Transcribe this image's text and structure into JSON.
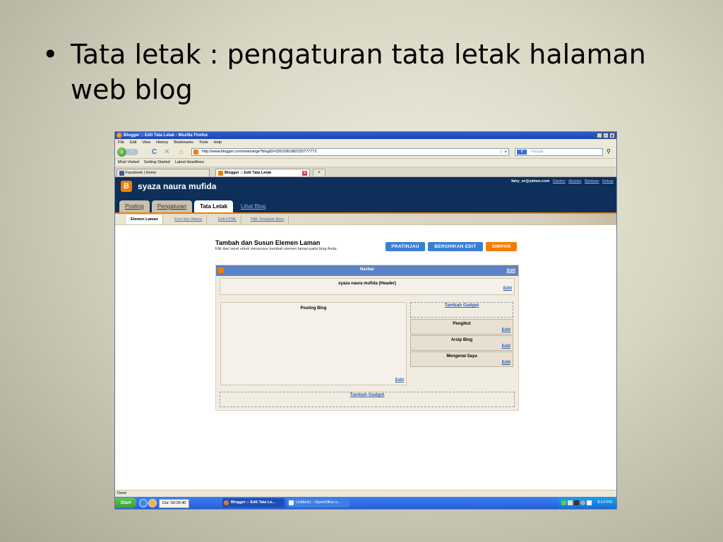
{
  "slide": {
    "bullet": "•",
    "title": "Tata letak : pengaturan tata letak halaman web blog"
  },
  "window": {
    "title": "Blogger :: Edit Tata Letak - Mozilla Firefox",
    "min": "_",
    "max": "▫",
    "close": "x"
  },
  "menu": [
    "File",
    "Edit",
    "View",
    "History",
    "Bookmarks",
    "Tools",
    "Help"
  ],
  "nav": {
    "url": "http://www.blogger.com/rearrange?blogID=3201081982155777772",
    "search_placeholder": "Google",
    "back_glyph": "‹",
    "fwd_glyph": "›",
    "reload_glyph": "C",
    "stop_glyph": "✕",
    "home_glyph": "⌂",
    "star_glyph": "☆ ▾",
    "search_glyph": "⚲",
    "g_label": "8"
  },
  "bookmarks": [
    "Most Visited",
    "Getting Started",
    "Latest Headlines"
  ],
  "tabs": [
    {
      "label": "Facebook | Home"
    },
    {
      "label": "Blogger :: Edit Tata Letak"
    }
  ],
  "tab_close": "x",
  "tab_new": "+",
  "blogger": {
    "logo": "B",
    "blog_name": "syaza naura mufida",
    "user_email": "fairy_er@yahoo.com",
    "user_links": [
      "Dasbor",
      "Akunku",
      "Bantuan",
      "Keluar"
    ],
    "main_tabs": [
      "Posting",
      "Pengaturan",
      "Tata Letak",
      "Lihat Blog"
    ],
    "sub_tabs": [
      "Elemen Laman",
      "Font dan Warna",
      "Edit HTML",
      "Pilih Template Baru"
    ]
  },
  "page": {
    "title": "Tambah dan Susun Elemen Laman",
    "subtitle": "Klik dan seret untuk menyusun kembali elemen laman pada blog Anda.",
    "buttons": {
      "preview": "PRATINJAU",
      "clear": "BERSIHKAN EDIT",
      "save": "SIMPAN"
    }
  },
  "layout": {
    "navbar": "Navbar",
    "header": "syaza naura mufida (Header)",
    "posts": "Posting Blog",
    "add_gadget": "Tambah Gadget",
    "sidebar": [
      "Pengikut",
      "Arsip Blog",
      "Mengenai Saya"
    ],
    "edit": "Edit"
  },
  "status": "Done",
  "taskbar": {
    "start": "Start",
    "timer": "Dur: 00:26:40",
    "items": [
      "Blogger :: Edit Tata Le...",
      "Untitled1 - OpenOffice.o..."
    ],
    "clock": "8:14 PM"
  },
  "colors": {
    "blogger_navy": "#0d2f5a",
    "blogger_orange": "#f57d00",
    "button_blue": "#3a7fd6",
    "link_blue": "#2a5db0"
  }
}
